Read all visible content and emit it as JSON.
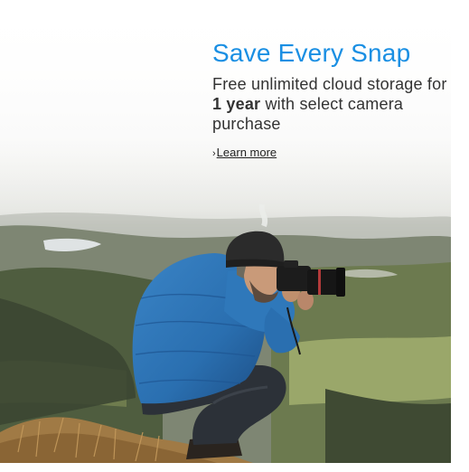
{
  "promo": {
    "headline": "Save Every Snap",
    "subline_part1": "Free unlimited cloud storage for ",
    "subline_bold": "1 year",
    "subline_part2": " with select camera purchase",
    "link_chevron": "›",
    "link_label": "Learn more"
  },
  "colors": {
    "headline": "#1a8fe3",
    "jacket": "#2a6fb0",
    "beanie": "#2b2b2b"
  },
  "image": {
    "subject": "photographer-crouching-on-hilltop",
    "background": "misty-mountain-valley"
  }
}
